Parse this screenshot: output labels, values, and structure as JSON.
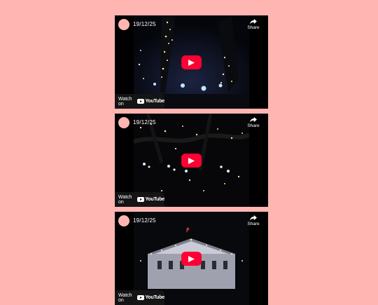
{
  "embeds": [
    {
      "title": "19/12/25",
      "share_label": "Share",
      "watch_on_label": "Watch on",
      "youtube_label": "YouTube",
      "scene": "tree-lined avenue with christmas lights and car headlights"
    },
    {
      "title": "19/12/25",
      "share_label": "Share",
      "watch_on_label": "Watch on",
      "youtube_label": "YouTube",
      "scene": "branches with hanging christmas lights at night"
    },
    {
      "title": "19/12/25",
      "share_label": "Share",
      "watch_on_label": "Watch on",
      "youtube_label": "YouTube",
      "scene": "illuminated palace facade at night"
    }
  ],
  "colors": {
    "background": "#ffb6b2",
    "play_button": "#ff0033",
    "embed_bg": "#000000"
  }
}
